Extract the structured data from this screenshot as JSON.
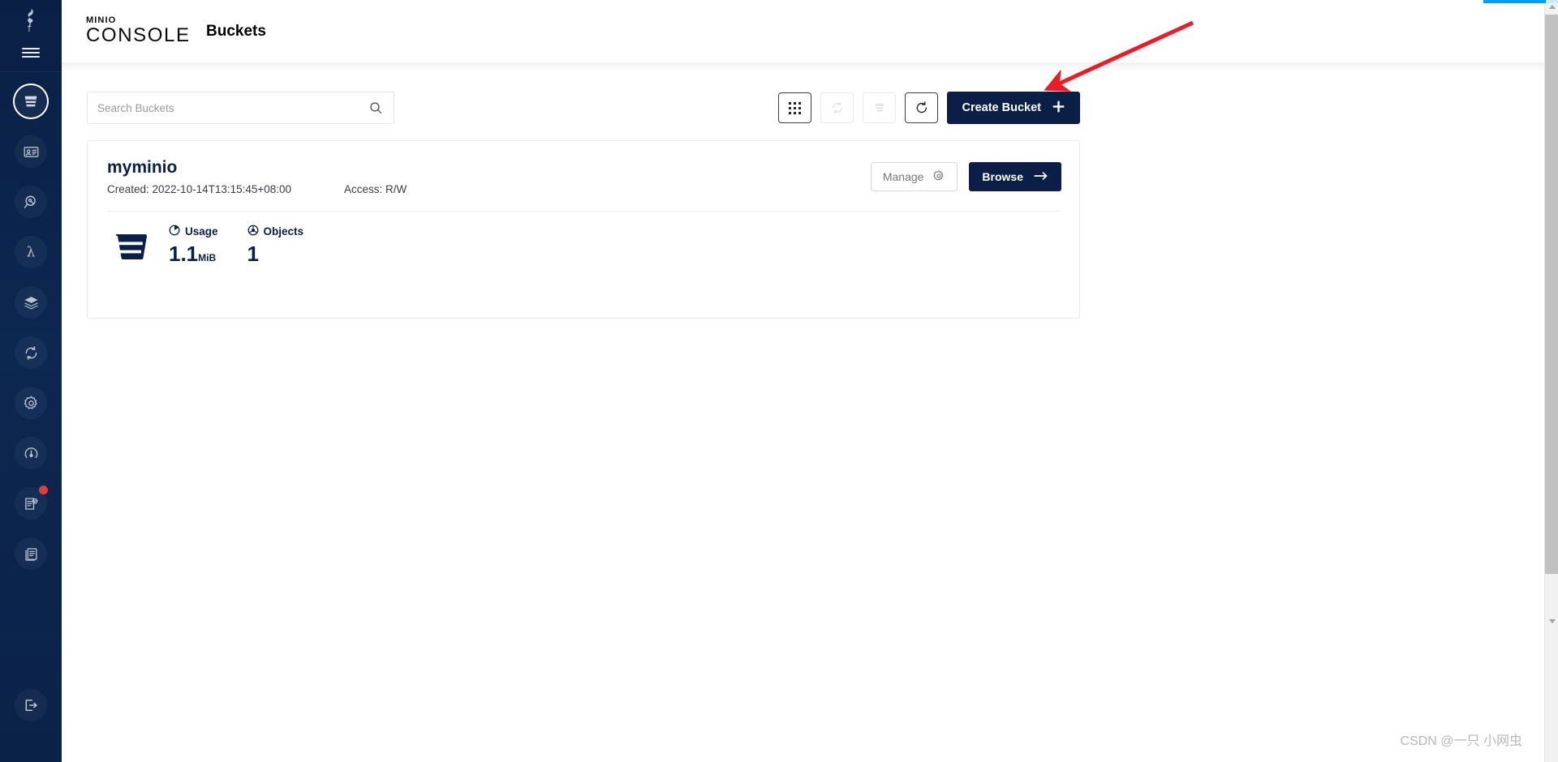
{
  "header": {
    "brand_mini": "MINIO",
    "brand_console": "CONSOLE",
    "page_title": "Buckets"
  },
  "sidebar": {
    "logo_icon": "minio-bird-logo",
    "menu_icon": "hamburger-menu-icon",
    "items": [
      {
        "name": "buckets",
        "icon": "bucket-icon",
        "active": true,
        "badge": false
      },
      {
        "name": "identity",
        "icon": "identity-card-icon",
        "active": false,
        "badge": false
      },
      {
        "name": "access-inspector",
        "icon": "magnifier-key-icon",
        "active": false,
        "badge": false
      },
      {
        "name": "lambda",
        "icon": "lambda-icon",
        "active": false,
        "badge": false
      },
      {
        "name": "tiers",
        "icon": "layers-icon",
        "active": false,
        "badge": false
      },
      {
        "name": "site-replication",
        "icon": "replication-refresh-icon",
        "active": false,
        "badge": false
      },
      {
        "name": "settings",
        "icon": "gear-icon",
        "active": false,
        "badge": false
      },
      {
        "name": "monitoring",
        "icon": "monitoring-icon",
        "active": false,
        "badge": false
      },
      {
        "name": "license",
        "icon": "document-check-icon",
        "active": false,
        "badge": true
      },
      {
        "name": "documentation",
        "icon": "book-icon",
        "active": false,
        "badge": false
      }
    ],
    "logout_icon": "logout-icon"
  },
  "search": {
    "placeholder": "Search Buckets",
    "value": "",
    "icon": "search-icon"
  },
  "toolbar": {
    "buttons": [
      {
        "name": "grid-view-toggle",
        "icon": "grid-icon",
        "disabled": false
      },
      {
        "name": "set-replication",
        "icon": "replication-icon",
        "disabled": true
      },
      {
        "name": "delete-selected-buckets",
        "icon": "bucket-delete-icon",
        "disabled": true
      },
      {
        "name": "refresh-list",
        "icon": "refresh-icon",
        "disabled": false
      }
    ],
    "create_label": "Create Bucket",
    "create_icon": "plus-icon"
  },
  "bucket": {
    "name": "myminio",
    "created_label": "Created: 2022-10-14T13:15:45+08:00",
    "access_label": "Access: R/W",
    "manage_label": "Manage",
    "manage_icon": "gear-icon",
    "browse_label": "Browse",
    "browse_icon": "arrow-right-icon",
    "bucket_icon": "bucket-icon",
    "stats": [
      {
        "label": "Usage",
        "icon": "pie-clock-icon",
        "value": "1.1",
        "unit": "MiB"
      },
      {
        "label": "Objects",
        "icon": "objects-globe-icon",
        "value": "1",
        "unit": ""
      }
    ]
  },
  "annotation": {
    "arrow_color": "#ee1b24",
    "target": "create-bucket-button"
  },
  "watermark": {
    "text": "CSDN @一只 小网虫"
  },
  "colors": {
    "sidebar_navy": "#0b2248",
    "primary_navy": "#0b1f46",
    "accent_blue": "#029cfd",
    "badge_red": "#e23c3c"
  }
}
